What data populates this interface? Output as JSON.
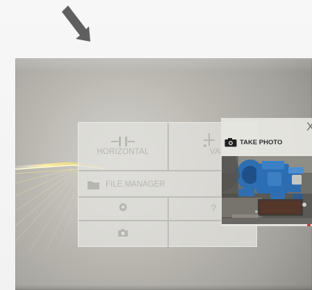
{
  "menu": {
    "horizontal_label": "HORIZONTAL",
    "values_label": "VALU",
    "file_manager_label": "FILE MANAGER",
    "help_label": "?"
  },
  "photo_panel": {
    "take_photo_label": "TAKE PHOTO",
    "close_label": "X"
  },
  "icons": {
    "pointer": "pointer-arrow-icon",
    "horizontal": "horizontal-shaft-icon",
    "values": "values-icon",
    "folder": "folder-icon",
    "settings": "gear-icon",
    "camera": "camera-icon",
    "help": "question-icon",
    "close": "close-icon"
  },
  "colors": {
    "background": "#f5f5f5",
    "screen": "#bdbbb4",
    "menu_text": "#b7b7b1",
    "accent": "#a8d0f8",
    "photo_blue": "#2f6fb1",
    "panel": "#e6e6e0"
  }
}
